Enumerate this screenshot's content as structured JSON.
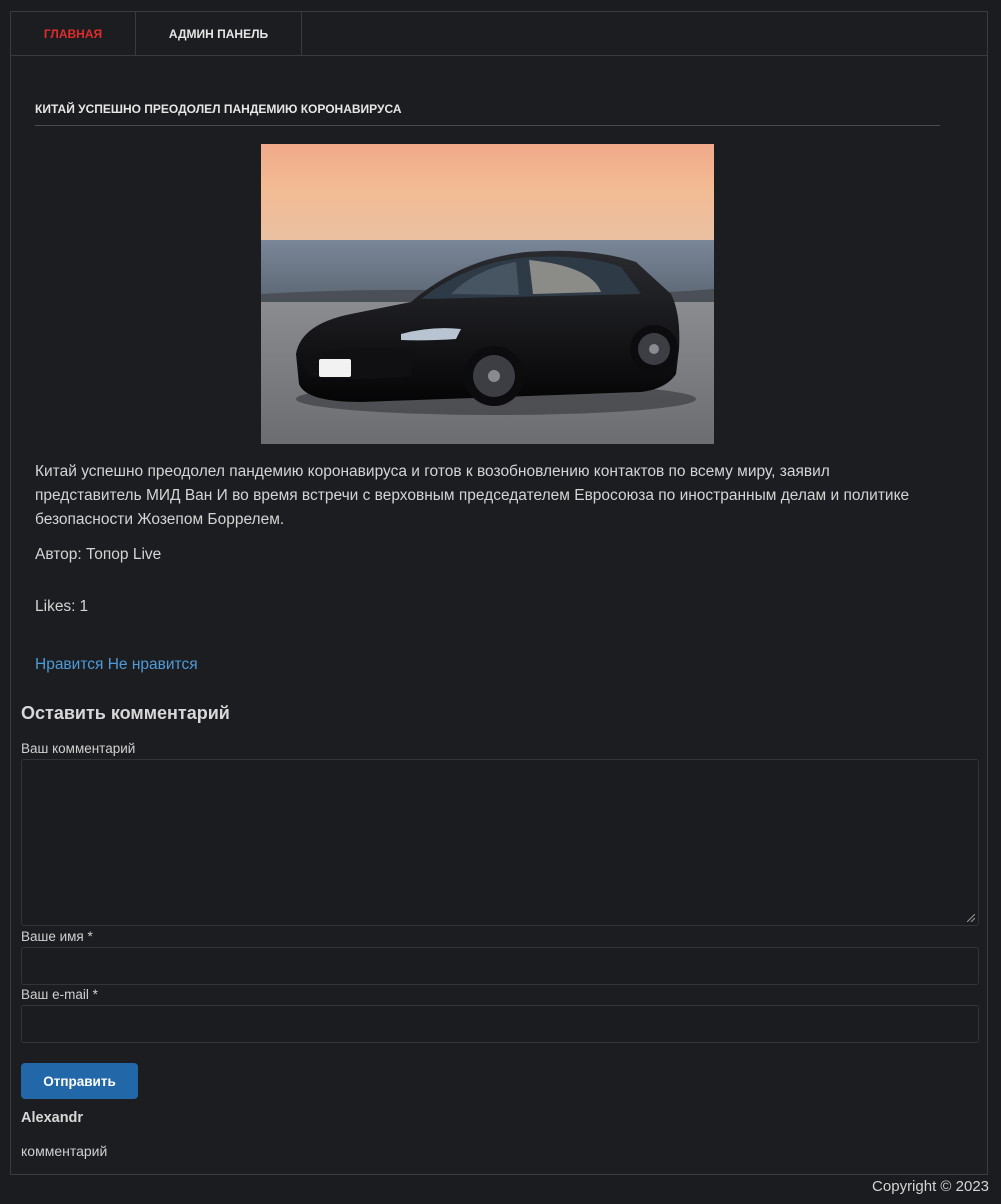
{
  "nav": {
    "items": [
      {
        "label": "ГЛАВНАЯ",
        "active": true
      },
      {
        "label": "АДМИН ПАНЕЛЬ",
        "active": false
      }
    ]
  },
  "article": {
    "title": "КИТАЙ УСПЕШНО ПРЕОДОЛЕЛ ПАНДЕМИЮ КОРОНАВИРУСА",
    "image_subject": "black sedan on seaside road at sunset",
    "body": "Китай успешно преодолел пандемию коронавируса и готов к возобновлению контактов по всему миру, заявил представитель МИД Ван И во время встречи с верховным председателем Евросоюза по иностранным делам и политике безопасности Жозепом Боррелем.",
    "author": "Автор: Топор Live",
    "likes_label": "Likes:",
    "likes_value": "1",
    "like_link": "Нравится",
    "dislike_link": "Не нравится"
  },
  "comment_form": {
    "heading": "Оставить комментарий",
    "comment_label": "Ваш комментарий",
    "comment_value": "",
    "name_label": "Ваше имя *",
    "name_value": "",
    "email_label": "Ваш e-mail *",
    "email_value": "",
    "submit_label": "Отправить"
  },
  "comments": [
    {
      "author": "Alexandr",
      "text": "комментарий"
    }
  ],
  "footer": {
    "copyright": "Copyright © 2023"
  },
  "colors": {
    "background": "#1b1c1f",
    "active_nav": "#e02b2b",
    "link": "#4f9ad8",
    "button": "#2267a8"
  }
}
